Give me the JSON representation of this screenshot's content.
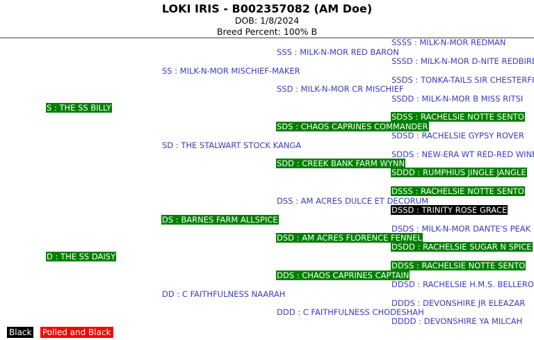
{
  "header": {
    "title": "LOKI IRIS - B002357082 (AM Doe)",
    "dob": "DOB: 1/8/2024",
    "breed_percent": "Breed Percent: 100% B"
  },
  "pedigree": {
    "S": "S : THE SS BILLY",
    "D": "D : THE SS DAISY",
    "SS": "SS : MILK-N-MOR MISCHIEF-MAKER",
    "SD": "SD : THE STALWART STOCK KANGA",
    "DS": "DS : BARNES FARM ALLSPICE",
    "DD": "DD : C FAITHFULNESS NAARAH",
    "SSS": "SSS : MILK-N-MOR RED BARON",
    "SSD": "SSD : MILK-N-MOR CR MISCHIEF",
    "SDS": "SDS : CHAOS CAPRINES COMMANDER",
    "SDD": "SDD : CREEK BANK FARM WYNN",
    "DSS": "DSS : AM ACRES DULCE ET DECORUM",
    "DSD": "DSD : AM ACRES FLORENCE FENNEL",
    "DDS": "DDS : CHAOS CAPRINES CAPTAIN",
    "DDD": "DDD : C FAITHFULNESS CHODESHAH",
    "SSSS": "SSSS : MILK-N-MOR REDMAN",
    "SSSD": "SSSD : MILK-N-MOR D-NITE REDBIRD",
    "SSDS": "SSDS : TONKA-TAILS SIR CHESTERFIELD",
    "SSDD": "SSDD : MILK-N-MOR B MISS RITSI",
    "SDSS": "SDSS : RACHELSIE NOTTE SENTO",
    "SDSD": "SDSD : RACHELSIE GYPSY ROVER",
    "SDDS": "SDDS : NEW-ERA WT RED-RED WINE",
    "SDDD": "SDDD : RUMPHIUS JINGLE JANGLE",
    "DSSS": "DSSS : RACHELSIE NOTTE SENTO",
    "DSSD": "DSSD : TRINITY ROSE GRACE",
    "DSDS": "DSDS : MILK-N-MOR DANTE'S PEAK",
    "DSDD": "DSDD : RACHELSIE SUGAR N SPICE",
    "DDSS": "DDSS : RACHELSIE NOTTE SENTO",
    "DDSD": "DDSD : RACHELSIE H.M.S. BELLEROPHON",
    "DDDS": "DDDS : DEVONSHIRE JR ELEAZAR",
    "DDDD": "DDDD : DEVONSHIRE YA MILCAH"
  },
  "legend": {
    "black": "Black",
    "polled_black": "Polled and Black"
  },
  "colors": {
    "name_text": "#3a3ac0",
    "highlight_black": "#008000",
    "highlight_polled_black": "#000000",
    "legend_black": "#000000",
    "legend_polled_black": "#ff0000"
  }
}
